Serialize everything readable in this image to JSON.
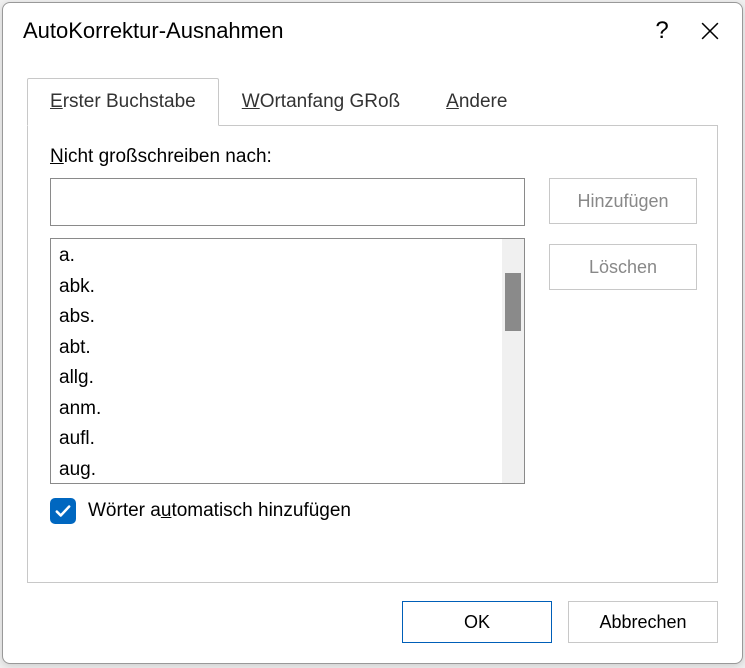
{
  "dialog": {
    "title": "AutoKorrektur-Ausnahmen",
    "help": "?",
    "close": "×"
  },
  "tabs": {
    "t0_pre": "E",
    "t0_rest": "rster Buchstabe",
    "t1_pre": "W",
    "t1_rest": "Ortanfang GRoß",
    "t2_pre": "A",
    "t2_rest": "ndere"
  },
  "panel": {
    "label_pre": "N",
    "label_rest": "icht großschreiben nach:",
    "input_value": "",
    "items": [
      "a.",
      "abk.",
      "abs.",
      "abt.",
      "allg.",
      "anm.",
      "aufl.",
      "aug."
    ]
  },
  "buttons": {
    "add": "Hinzufügen",
    "delete": "Löschen"
  },
  "checkbox": {
    "pre": "Wörter a",
    "ul": "u",
    "post": "tomatisch hinzufügen",
    "checked": true
  },
  "footer": {
    "ok": "OK",
    "cancel": "Abbrechen"
  }
}
